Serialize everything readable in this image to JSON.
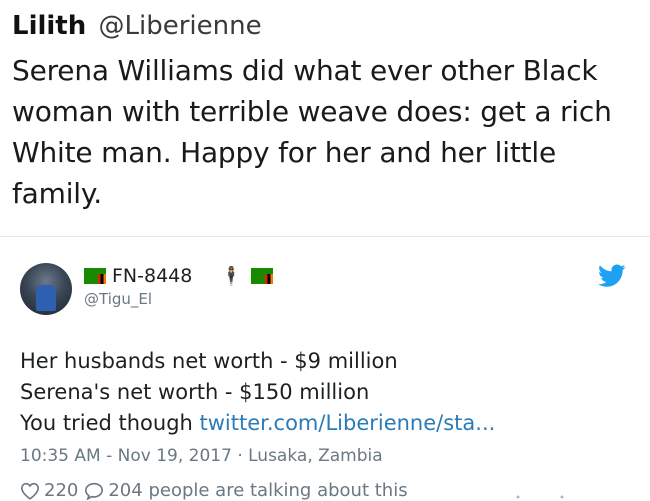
{
  "quoted_tweet": {
    "name": "Lilith",
    "handle": "@Liberienne",
    "text": "Serena Williams did what ever other Black woman with terrible weave does: get a rich White man. Happy for her and her little family."
  },
  "tweet": {
    "display_name": "FN-8448",
    "handle": "@Tigu_El",
    "body_lines": [
      "Her husbands net worth - $9 million",
      "Serena's net worth - $150 million",
      "You tried though "
    ],
    "link_text": "twitter.com/Liberienne/sta...",
    "timestamp": "10:35 AM - Nov 19, 2017 · Lusaka, Zambia",
    "likes": "220",
    "talking": "204 people are talking about this"
  },
  "icons": {
    "brand": "twitter-bird-icon",
    "like": "heart-icon",
    "reply": "speech-bubble-icon",
    "flag": "zambia-flag-icon",
    "person": "person-emoji-icon"
  },
  "colors": {
    "link": "#2b7bb9",
    "twitter_blue": "#1da1f2",
    "muted": "#697882"
  }
}
